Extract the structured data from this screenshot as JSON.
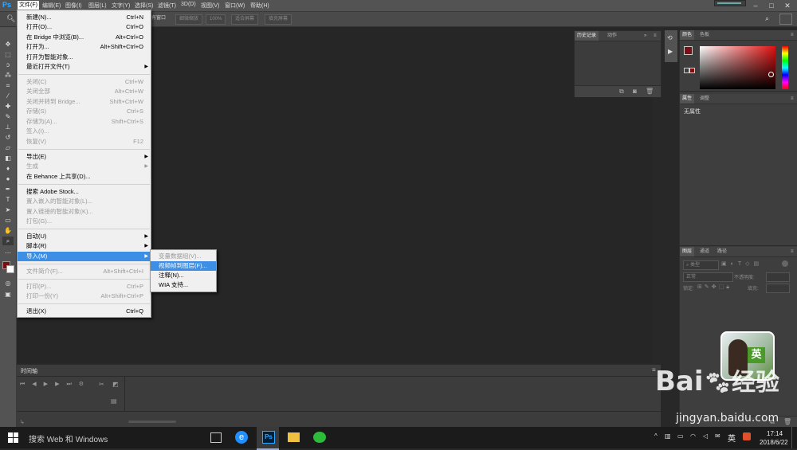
{
  "app": {
    "logo": "Ps"
  },
  "menubar": {
    "items": [
      "文件(F)",
      "编辑(E)",
      "图像(I)",
      "图层(L)",
      "文字(Y)",
      "选择(S)",
      "滤镜(T)",
      "3D(D)",
      "视图(V)",
      "窗口(W)",
      "帮助(H)"
    ]
  },
  "options_bar": {
    "buttons": [
      "有窗口",
      "细微缩放",
      "100%",
      "适合屏幕",
      "填充屏幕"
    ]
  },
  "file_menu": {
    "items": [
      {
        "label": "新建(N)...",
        "shortcut": "Ctrl+N",
        "enabled": true
      },
      {
        "label": "打开(O)...",
        "shortcut": "Ctrl+O",
        "enabled": true
      },
      {
        "label": "在 Bridge 中浏览(B)...",
        "shortcut": "Alt+Ctrl+O",
        "enabled": true
      },
      {
        "label": "打开为...",
        "shortcut": "Alt+Shift+Ctrl+O",
        "enabled": true
      },
      {
        "label": "打开为智能对象...",
        "shortcut": "",
        "enabled": true
      },
      {
        "label": "最近打开文件(T)",
        "shortcut": "",
        "enabled": true,
        "submenu": true
      },
      {
        "label": "关闭(C)",
        "shortcut": "Ctrl+W",
        "enabled": false
      },
      {
        "label": "关闭全部",
        "shortcut": "Alt+Ctrl+W",
        "enabled": false
      },
      {
        "label": "关闭并转到 Bridge...",
        "shortcut": "Shift+Ctrl+W",
        "enabled": false
      },
      {
        "label": "存储(S)",
        "shortcut": "Ctrl+S",
        "enabled": false
      },
      {
        "label": "存储为(A)...",
        "shortcut": "Shift+Ctrl+S",
        "enabled": false
      },
      {
        "label": "签入(I)...",
        "shortcut": "",
        "enabled": false
      },
      {
        "label": "恢复(V)",
        "shortcut": "F12",
        "enabled": false
      },
      {
        "label": "导出(E)",
        "shortcut": "",
        "enabled": true,
        "submenu": true
      },
      {
        "label": "生成",
        "shortcut": "",
        "enabled": false,
        "submenu": true
      },
      {
        "label": "在 Behance 上共享(D)...",
        "shortcut": "",
        "enabled": true
      },
      {
        "label": "搜索 Adobe Stock...",
        "shortcut": "",
        "enabled": true
      },
      {
        "label": "置入嵌入的智能对象(L)...",
        "shortcut": "",
        "enabled": false
      },
      {
        "label": "置入链接的智能对象(K)...",
        "shortcut": "",
        "enabled": false
      },
      {
        "label": "打包(G)...",
        "shortcut": "",
        "enabled": false
      },
      {
        "label": "自动(U)",
        "shortcut": "",
        "enabled": true,
        "submenu": true
      },
      {
        "label": "脚本(R)",
        "shortcut": "",
        "enabled": true,
        "submenu": true
      },
      {
        "label": "导入(M)",
        "shortcut": "",
        "enabled": true,
        "submenu": true,
        "highlighted": true
      },
      {
        "label": "文件简介(F)...",
        "shortcut": "Alt+Shift+Ctrl+I",
        "enabled": false
      },
      {
        "label": "打印(P)...",
        "shortcut": "Ctrl+P",
        "enabled": false
      },
      {
        "label": "打印一份(Y)",
        "shortcut": "Alt+Shift+Ctrl+P",
        "enabled": false
      },
      {
        "label": "退出(X)",
        "shortcut": "Ctrl+Q",
        "enabled": true
      }
    ]
  },
  "import_submenu": {
    "items": [
      {
        "label": "变量数据组(V)...",
        "enabled": false
      },
      {
        "label": "视频帧到图层(F)...",
        "enabled": true,
        "highlighted": true
      },
      {
        "label": "注释(N)...",
        "enabled": true
      },
      {
        "label": "WIA 支持...",
        "enabled": true
      }
    ]
  },
  "history_panel": {
    "tabs": [
      "历史记录",
      "动作"
    ]
  },
  "color_panel": {
    "tabs": [
      "颜色",
      "色板"
    ]
  },
  "properties_panel": {
    "tabs": [
      "属性",
      "调整"
    ],
    "empty_text": "无属性"
  },
  "layers_panel": {
    "tabs": [
      "图层",
      "通道",
      "路径"
    ],
    "filter_label": "类型",
    "blend_mode": "正常",
    "opacity_label": "不透明度:",
    "lock_label": "锁定:",
    "fill_label": "填充:"
  },
  "timeline_panel": {
    "title": "时间轴"
  },
  "taskbar": {
    "search_placeholder": "搜索 Web 和 Windows",
    "ime": "英",
    "time": "17:14",
    "date": "2018/6/22"
  },
  "watermark": {
    "brand_a": "Bai",
    "brand_b": "经验",
    "url": "jingyan.baidu.com",
    "badge": "英"
  },
  "colors": {
    "foreground": "#7a1010",
    "background": "#ffffff",
    "menu_highlight": "#3c8fe5",
    "accent": "#31a8ff"
  }
}
